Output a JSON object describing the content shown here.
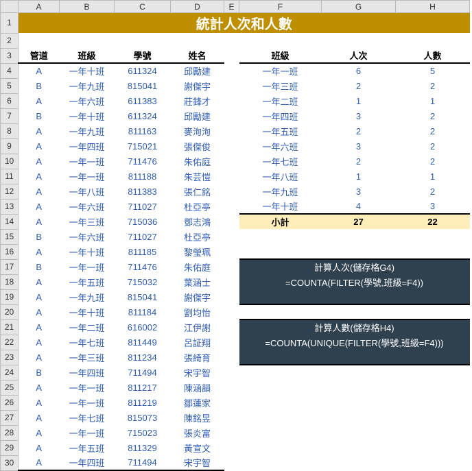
{
  "columns": [
    "A",
    "B",
    "C",
    "D",
    "E",
    "F",
    "G",
    "H"
  ],
  "rows_count": 30,
  "title": "統計人次和人數",
  "left": {
    "headers": {
      "a": "管道",
      "b": "班級",
      "c": "學號",
      "d": "姓名"
    },
    "rows": [
      {
        "a": "A",
        "b": "一年十班",
        "c": "611324",
        "d": "邱勵建"
      },
      {
        "a": "B",
        "b": "一年九班",
        "c": "815041",
        "d": "謝傑宇"
      },
      {
        "a": "A",
        "b": "一年六班",
        "c": "611383",
        "d": "莊鋒才"
      },
      {
        "a": "B",
        "b": "一年十班",
        "c": "611324",
        "d": "邱勵建"
      },
      {
        "a": "A",
        "b": "一年九班",
        "c": "811163",
        "d": "麥洵洵"
      },
      {
        "a": "A",
        "b": "一年四班",
        "c": "715021",
        "d": "張傑俊"
      },
      {
        "a": "A",
        "b": "一年一班",
        "c": "711476",
        "d": "朱佑庭"
      },
      {
        "a": "A",
        "b": "一年一班",
        "c": "811188",
        "d": "朱芸愷"
      },
      {
        "a": "A",
        "b": "一年八班",
        "c": "811383",
        "d": "張仁銘"
      },
      {
        "a": "A",
        "b": "一年六班",
        "c": "711027",
        "d": "杜亞亭"
      },
      {
        "a": "A",
        "b": "一年三班",
        "c": "715036",
        "d": "鄧志鴻"
      },
      {
        "a": "B",
        "b": "一年六班",
        "c": "711027",
        "d": "杜亞亭"
      },
      {
        "a": "A",
        "b": "一年十班",
        "c": "811185",
        "d": "黎瑩珮"
      },
      {
        "a": "B",
        "b": "一年一班",
        "c": "711476",
        "d": "朱佑庭"
      },
      {
        "a": "A",
        "b": "一年五班",
        "c": "715032",
        "d": "葉涵士"
      },
      {
        "a": "A",
        "b": "一年九班",
        "c": "815041",
        "d": "謝傑宇"
      },
      {
        "a": "A",
        "b": "一年十班",
        "c": "811184",
        "d": "劉均怡"
      },
      {
        "a": "A",
        "b": "一年二班",
        "c": "616002",
        "d": "江伊謝"
      },
      {
        "a": "A",
        "b": "一年七班",
        "c": "811449",
        "d": "呂証翔"
      },
      {
        "a": "A",
        "b": "一年三班",
        "c": "811234",
        "d": "張綺育"
      },
      {
        "a": "B",
        "b": "一年四班",
        "c": "711494",
        "d": "宋宇智"
      },
      {
        "a": "A",
        "b": "一年一班",
        "c": "811217",
        "d": "陳涵韻"
      },
      {
        "a": "A",
        "b": "一年一班",
        "c": "811219",
        "d": "鄒蓮家"
      },
      {
        "a": "A",
        "b": "一年七班",
        "c": "815073",
        "d": "陳銘昱"
      },
      {
        "a": "A",
        "b": "一年一班",
        "c": "715023",
        "d": "張炎富"
      },
      {
        "a": "A",
        "b": "一年五班",
        "c": "811329",
        "d": "黃宣文"
      },
      {
        "a": "A",
        "b": "一年四班",
        "c": "711494",
        "d": "宋宇智"
      }
    ]
  },
  "right": {
    "headers": {
      "f": "班級",
      "g": "人次",
      "h": "人數"
    },
    "rows": [
      {
        "f": "一年一班",
        "g": "6",
        "h": "5"
      },
      {
        "f": "一年三班",
        "g": "2",
        "h": "2"
      },
      {
        "f": "一年二班",
        "g": "1",
        "h": "1"
      },
      {
        "f": "一年四班",
        "g": "3",
        "h": "2"
      },
      {
        "f": "一年五班",
        "g": "2",
        "h": "2"
      },
      {
        "f": "一年六班",
        "g": "3",
        "h": "2"
      },
      {
        "f": "一年七班",
        "g": "2",
        "h": "2"
      },
      {
        "f": "一年八班",
        "g": "1",
        "h": "1"
      },
      {
        "f": "一年九班",
        "g": "3",
        "h": "2"
      },
      {
        "f": "一年十班",
        "g": "4",
        "h": "3"
      }
    ],
    "subtotal": {
      "label": "小計",
      "g": "27",
      "h": "22"
    }
  },
  "box1": {
    "label": "計算人次(儲存格G4)",
    "formula": "=COUNTA(FILTER(學號,班級=F4))"
  },
  "box2": {
    "label": "計算人數(儲存格H4)",
    "formula": "=COUNTA(UNIQUE(FILTER(學號,班級=F4)))"
  }
}
